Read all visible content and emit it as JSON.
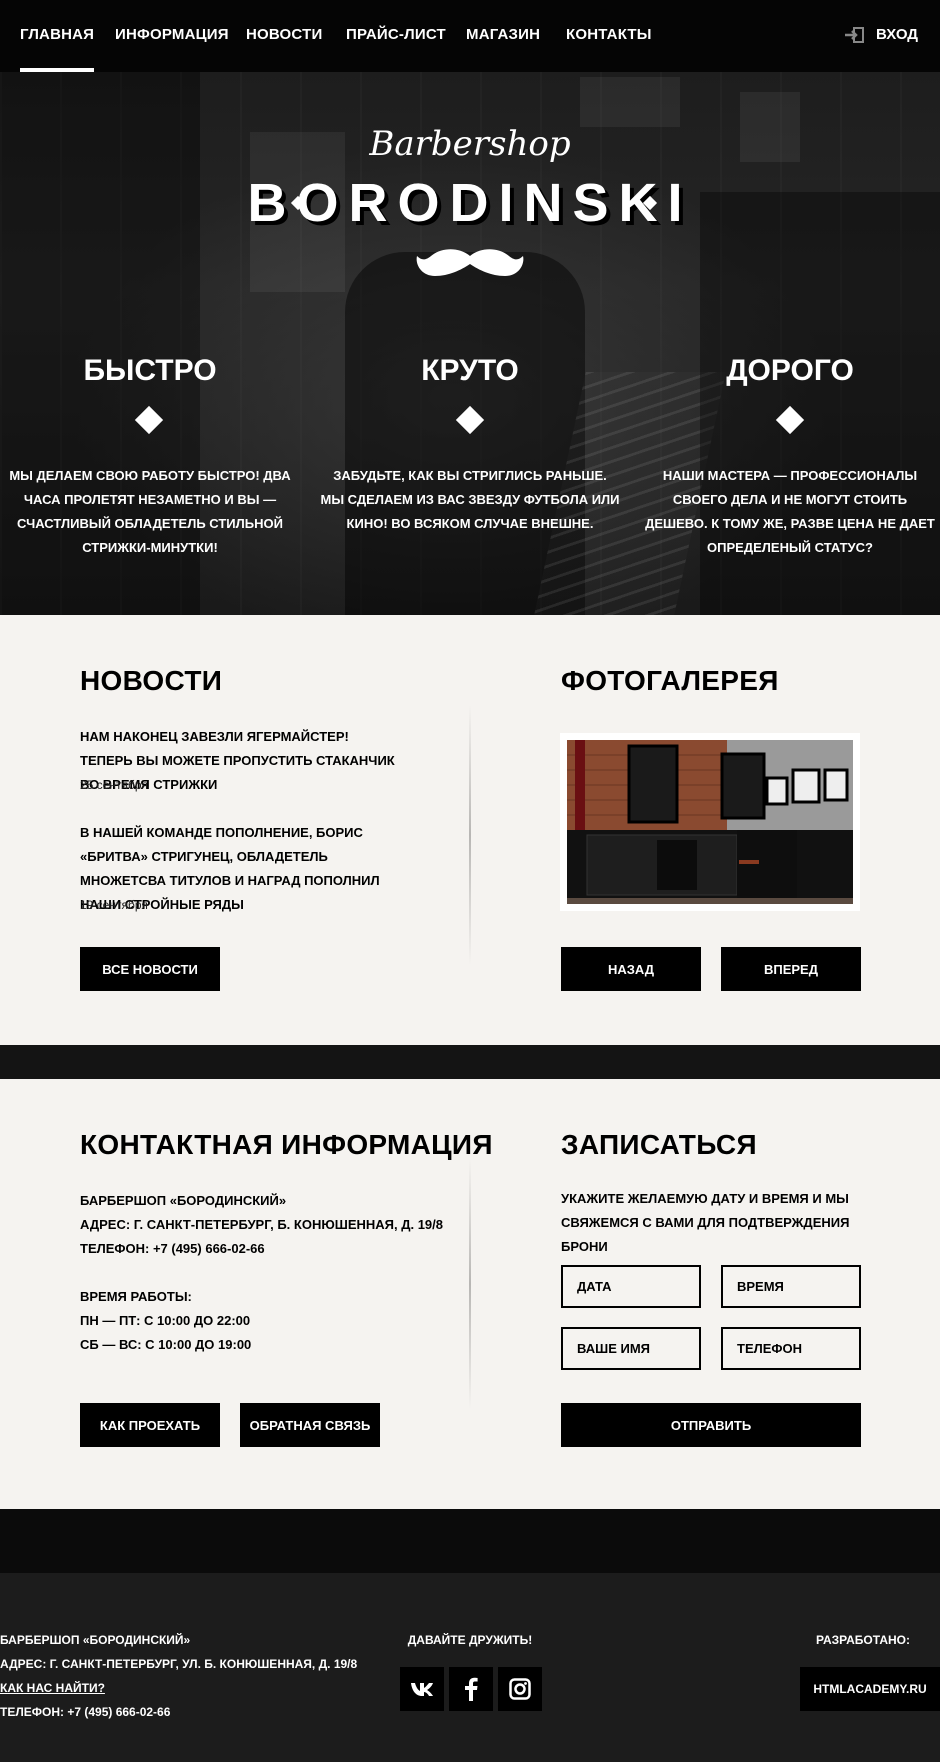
{
  "nav": {
    "items": [
      {
        "label": "ГЛАВНАЯ"
      },
      {
        "label": "ИНФОРМАЦИЯ"
      },
      {
        "label": "НОВОСТИ"
      },
      {
        "label": "ПРАЙС-ЛИСТ"
      },
      {
        "label": "МАГАЗИН"
      },
      {
        "label": "КОНТАКТЫ"
      }
    ],
    "login_label": "ВХОД"
  },
  "hero": {
    "logo_script": "Barbershop",
    "logo_main": "BORODINSKI",
    "features": [
      {
        "title": "БЫСТРО",
        "text": "МЫ ДЕЛАЕМ СВОЮ РАБОТУ БЫСТРО! ДВА ЧАСА ПРОЛЕТЯТ НЕЗАМЕТНО И ВЫ — СЧАСТЛИВЫЙ ОБЛАДЕТЕЛЬ СТИЛЬНОЙ СТРИЖКИ-МИНУТКИ!"
      },
      {
        "title": "КРУТО",
        "text": "ЗАБУДЬТЕ, КАК ВЫ СТРИГЛИСЬ РАНЬШЕ. МЫ СДЕЛАЕМ ИЗ ВАС ЗВЕЗДУ ФУТБОЛА ИЛИ КИНО! ВО ВСЯКОМ СЛУЧАЕ ВНЕШНЕ."
      },
      {
        "title": "ДОРОГО",
        "text": "НАШИ МАСТЕРА — ПРОФЕССИОНАЛЫ СВОЕГО ДЕЛА И НЕ МОГУТ СТОИТЬ ДЕШЕВО. К ТОМУ ЖЕ, РАЗВЕ ЦЕНА НЕ ДАЕТ ОПРЕДЕЛЕНЫЙ СТАТУС?"
      }
    ]
  },
  "news": {
    "title": "НОВОСТИ",
    "items": [
      {
        "text": "НАМ НАКОНЕЦ ЗАВЕЗЛИ ЯГЕРМАЙСТЕР! ТЕПЕРЬ ВЫ МОЖЕТЕ ПРОПУСТИТЬ СТАКАНЧИК ВО ВРЕМЯ СТРИЖКИ",
        "date": "25 сентября"
      },
      {
        "text": "В НАШЕЙ КОМАНДЕ ПОПОЛНЕНИЕ, БОРИС «БРИТВА» СТРИГУНЕЦ, ОБЛАДЕТЕЛЬ МНОЖЕТСВА ТИТУЛОВ И НАГРАД ПОПОЛНИЛ НАШИ СТРОЙНЫЕ РЯДЫ",
        "date": "19 сентября"
      }
    ],
    "all_button": "ВСЕ НОВОСТИ"
  },
  "gallery": {
    "title": "ФОТОГАЛЕРЕЯ",
    "prev_button": "НАЗАД",
    "next_button": "ВПЕРЕД"
  },
  "contacts": {
    "title": "КОНТАКТНАЯ ИНФОРМАЦИЯ",
    "name": "БАРБЕРШОП «БОРОДИНСКИЙ»",
    "address": "АДРЕС: Г. САНКТ-ПЕТЕРБУРГ, Б. КОНЮШЕННАЯ, Д. 19/8",
    "phone": "ТЕЛЕФОН: +7 (495) 666-02-66",
    "hours_title": "ВРЕМЯ РАБОТЫ:",
    "hours_weekdays": "ПН — ПТ: С 10:00 ДО 22:00",
    "hours_weekend": "СБ — ВС: С 10:00 ДО 19:00",
    "route_button": "КАК ПРОЕХАТЬ",
    "feedback_button": "ОБРАТНАЯ СВЯЗЬ"
  },
  "booking": {
    "title": "ЗАПИСАТЬСЯ",
    "note": "УКАЖИТЕ ЖЕЛАЕМУЮ ДАТУ И ВРЕМЯ И МЫ СВЯЖЕМСЯ С ВАМИ ДЛЯ ПОДТВЕРЖДЕНИЯ БРОНИ",
    "date_placeholder": "ДАТА",
    "time_placeholder": "ВРЕМЯ",
    "name_placeholder": "ВАШЕ ИМЯ",
    "phone_placeholder": "ТЕЛЕФОН",
    "submit_button": "ОТПРАВИТЬ"
  },
  "footer": {
    "name": "БАРБЕРШОП «БОРОДИНСКИЙ»",
    "address": "АДРЕС: Г. САНКТ-ПЕТЕРБУРГ, УЛ. Б. КОНЮШЕННАЯ, Д. 19/8",
    "find_link": "КАК НАС НАЙТИ?",
    "phone": "ТЕЛЕФОН: +7 (495) 666-02-66",
    "social_title": "ДАВАЙТЕ ДРУЖИТЬ!",
    "social_icons": [
      "vk-icon",
      "facebook-icon",
      "instagram-icon"
    ],
    "dev_title": "РАЗРАБОТАНО:",
    "dev_button": "HTMLACADEMY.RU"
  }
}
